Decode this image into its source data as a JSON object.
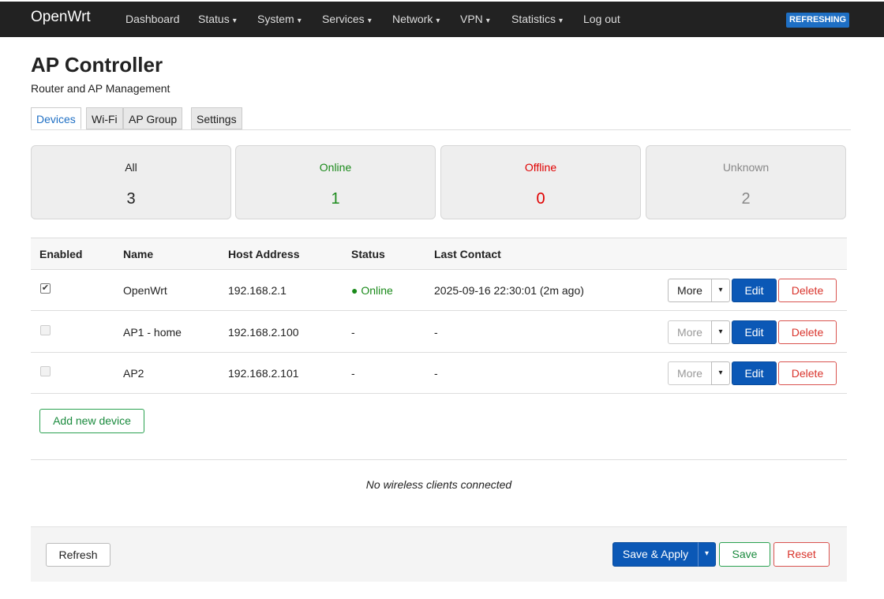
{
  "brand": "OpenWrt",
  "nav": [
    {
      "label": "Dashboard",
      "caret": ""
    },
    {
      "label": "Status",
      "caret": "▾"
    },
    {
      "label": "System",
      "caret": "▾"
    },
    {
      "label": "Services",
      "caret": "▾"
    },
    {
      "label": "Network",
      "caret": "▾"
    },
    {
      "label": "VPN",
      "caret": "▾"
    },
    {
      "label": "Statistics",
      "caret": "▾"
    },
    {
      "label": "Log out",
      "caret": ""
    }
  ],
  "refresh_badge": "REFRESHING",
  "page": {
    "title": "AP Controller",
    "subtitle": "Router and AP Management"
  },
  "tabs": [
    {
      "label": "Devices",
      "active": true
    },
    {
      "label": "Wi-Fi",
      "active": false
    },
    {
      "label": "AP Group",
      "active": false
    },
    {
      "label": "Settings",
      "active": false
    }
  ],
  "summary": [
    {
      "label": "All",
      "count": "3",
      "color": "#222222"
    },
    {
      "label": "Online",
      "count": "1",
      "color": "#1a8a1a"
    },
    {
      "label": "Offline",
      "count": "0",
      "color": "#e00000"
    },
    {
      "label": "Unknown",
      "count": "2",
      "color": "#888888"
    }
  ],
  "table": {
    "headers": [
      "Enabled",
      "Name",
      "Host Address",
      "Status",
      "Last Contact"
    ],
    "rows": [
      {
        "enabled": true,
        "name": "OpenWrt",
        "host": "192.168.2.1",
        "status": "● Online",
        "status_color": "#1a8a1a",
        "last_contact": "2025-09-16 22:30:01 (2m ago)",
        "more_enabled": true
      },
      {
        "enabled": false,
        "name": "AP1 - home",
        "host": "192.168.2.100",
        "status": "-",
        "status_color": "#222222",
        "last_contact": "-",
        "more_enabled": false
      },
      {
        "enabled": false,
        "name": "AP2",
        "host": "192.168.2.101",
        "status": "-",
        "status_color": "#222222",
        "last_contact": "-",
        "more_enabled": false
      }
    ],
    "buttons": {
      "more": "More",
      "caret": "▾",
      "edit": "Edit",
      "delete": "Delete"
    }
  },
  "add_device_label": "Add new device",
  "no_clients_text": "No wireless clients connected",
  "footer": {
    "refresh": "Refresh",
    "save_apply": "Save & Apply",
    "save_apply_caret": "▾",
    "save": "Save",
    "reset": "Reset"
  },
  "colors": {
    "navbar": "#222222",
    "primary": "#0b58b6",
    "success": "#2aa150",
    "danger": "#d9534f"
  }
}
